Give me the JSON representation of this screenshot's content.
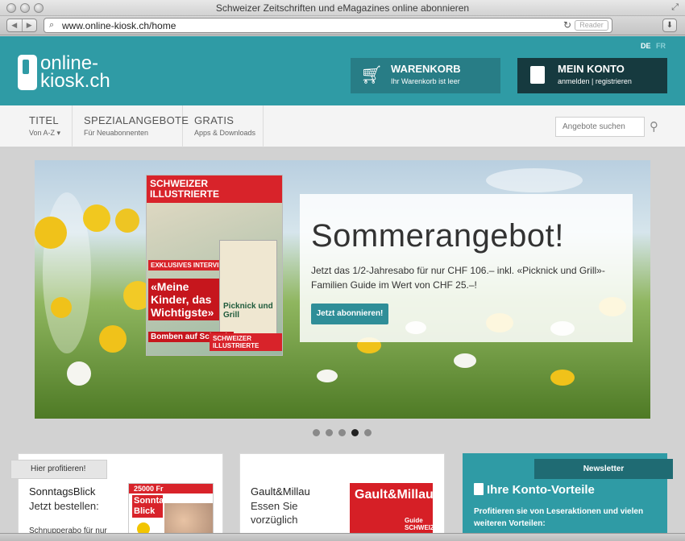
{
  "browser": {
    "window_title": "Schweizer Zeitschriften und eMagazines online abonnieren",
    "url": "www.online-kiosk.ch/home",
    "reader_label": "Reader",
    "back_glyph": "◀",
    "forward_glyph": "▶"
  },
  "header": {
    "lang_de": "DE",
    "lang_fr": "FR",
    "logo_line1": "online-",
    "logo_line2": "kiosk.ch",
    "cart": {
      "title": "WARENKORB",
      "status": "Ihr Warenkorb ist leer",
      "icon": "cart-icon"
    },
    "account": {
      "title": "MEIN KONTO",
      "links": "anmelden | registrieren",
      "icon": "book-icon"
    },
    "brand_color": "#2f9ba5"
  },
  "nav": {
    "items": [
      {
        "label": "TITEL",
        "sub": "Von A-Z ▾"
      },
      {
        "label": "SPEZIALANGEBOTE",
        "sub": "Für Neuabonnenten"
      },
      {
        "label": "GRATIS",
        "sub": "Apps & Downloads"
      }
    ],
    "search_placeholder": "Angebote suchen"
  },
  "hero": {
    "title": "Sommerangebot!",
    "text": "Jetzt das 1/2-Jahresabo für nur CHF 106.– inkl. «Picknick und Grill»-Familien Guide im Wert von CHF 25.–!",
    "cta": "Jetzt abonnieren!",
    "magazine": {
      "masthead": "SCHWEIZER ILLUSTRIERTE",
      "badge": "EXKLUSIVES INTERVIEW",
      "headline": "«Meine Kinder, das Wichtigste»",
      "side_title": "Picknick und Grill",
      "bottom": "Bomben auf Schweiz",
      "tag": "SCHWEIZER ILLUSTRIERTE"
    },
    "slides_total": 5,
    "active_slide": 3
  },
  "cards": [
    {
      "flag": "Hier profitieren!",
      "title": "SonntagsBlick",
      "subtitle": "Jetzt bestellen:",
      "small": "Schnupperabo für nur",
      "cover_band": "25000 Fr",
      "cover_title": "Sonntags Blick"
    },
    {
      "title": "Gault&Millau",
      "subtitle_1": "Essen Sie",
      "subtitle_2": "vorzüglich",
      "cover_title": "Gault&Millau",
      "cover_guide": "Guide SCHWEIZ"
    }
  ],
  "newsletter": {
    "tab": "Newsletter",
    "heading": "Ihre Konto-Vorteile",
    "body": "Profitieren sie von Leseraktionen und vielen weiteren Vorteilen:"
  }
}
